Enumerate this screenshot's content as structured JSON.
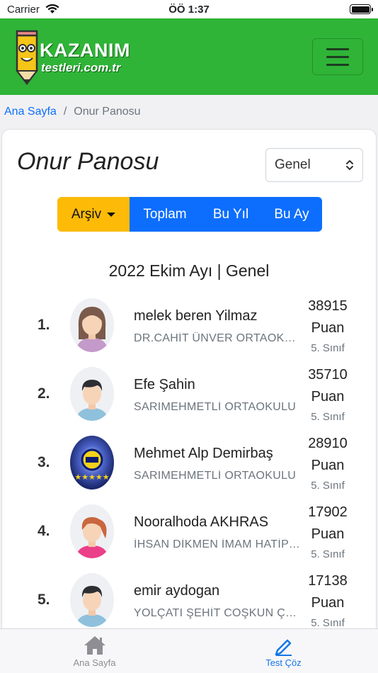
{
  "status_bar": {
    "carrier": "Carrier",
    "time": "ÖÖ 1:37"
  },
  "header": {
    "logo_line1": "KAZANIM",
    "logo_line2": "testleri.com.tr",
    "brand_color": "#2fb437"
  },
  "breadcrumb": {
    "home": "Ana Sayfa",
    "separator": "/",
    "current": "Onur Panosu"
  },
  "page": {
    "title": "Onur Panosu",
    "filter_select": {
      "selected": "Genel"
    },
    "period_buttons": {
      "archive": "Arşiv",
      "total": "Toplam",
      "year": "Bu Yıl",
      "month": "Bu Ay"
    },
    "subtitle": "2022 Ekim Ayı | Genel"
  },
  "leaderboard": [
    {
      "rank": "1.",
      "name": "melek beren Yilmaz",
      "school": "DR.CAHİT ÜNVER ORTAOKULU",
      "score": "38915",
      "unit": "Puan",
      "grade": "5. Sınıf",
      "avatar": "girl-avatar-icon"
    },
    {
      "rank": "2.",
      "name": "Efe Şahin",
      "school": "SARIMEHMETLİ ORTAOKULU",
      "score": "35710",
      "unit": "Puan",
      "grade": "5. Sınıf",
      "avatar": "boy-avatar-icon"
    },
    {
      "rank": "3.",
      "name": "Mehmet Alp Demirbaş",
      "school": "SARIMEHMETLİ ORTAOKULU",
      "score": "28910",
      "unit": "Puan",
      "grade": "5. Sınıf",
      "avatar": "club-badge-icon"
    },
    {
      "rank": "4.",
      "name": "Nooralhoda AKHRAS",
      "school": "İHSAN DİKMEN İMAM HATİP ORTAOKULU",
      "score": "17902",
      "unit": "Puan",
      "grade": "5. Sınıf",
      "avatar": "girl-ponytail-avatar-icon"
    },
    {
      "rank": "5.",
      "name": "emir aydogan",
      "school": "YOLÇATI ŞEHİT COŞKUN ÇAKIR ORTAOKULU",
      "score": "17138",
      "unit": "Puan",
      "grade": "5. Sınıf",
      "avatar": "boy-avatar-icon"
    }
  ],
  "tab_bar": {
    "home": {
      "label": "Ana Sayfa",
      "icon": "home-icon"
    },
    "test": {
      "label": "Test Çöz",
      "icon": "pencil-icon"
    }
  }
}
